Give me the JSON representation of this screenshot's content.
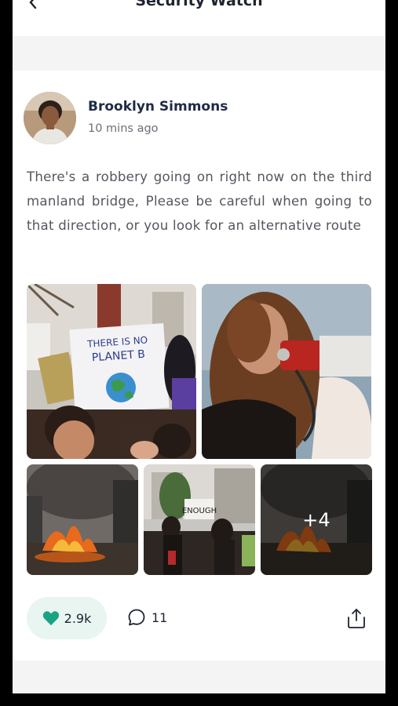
{
  "header": {
    "title": "Security Watch"
  },
  "post": {
    "author": "Brooklyn Simmons",
    "time": "10 mins ago",
    "body": "There's a robbery going on right now on the third manland bridge, Please be careful when going to that direction, or you look for an alternative route",
    "photos": [
      {
        "name": "protest-crowd-photo",
        "sign_line1": "THERE IS NO",
        "sign_line2": "PLANET B"
      },
      {
        "name": "megaphone-protester-photo"
      },
      {
        "name": "street-fire-photo"
      },
      {
        "name": "protest-street-photo",
        "sign": "ENOUGH"
      },
      {
        "name": "street-fire-more-photo"
      }
    ],
    "more_photos": "+4",
    "likes": "2.9k",
    "comments": "11"
  },
  "colors": {
    "like": "#1aa383",
    "like_bg": "#e8f5f1",
    "text": "#54575f",
    "name": "#1f2a44"
  },
  "icons": {
    "back": "chevron-left-icon",
    "like": "heart-icon",
    "comment": "comment-icon",
    "share": "share-icon"
  }
}
